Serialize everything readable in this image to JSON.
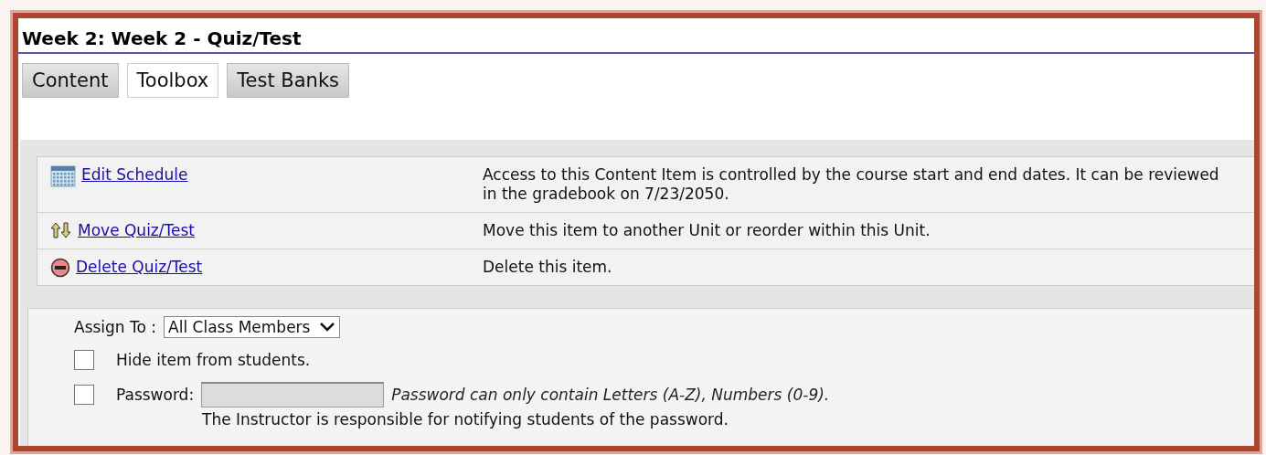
{
  "title": "Week 2: Week 2 - Quiz/Test",
  "tabs": [
    {
      "label": "Content",
      "selected": false
    },
    {
      "label": "Toolbox",
      "selected": true
    },
    {
      "label": "Test Banks",
      "selected": false
    }
  ],
  "actions": [
    {
      "kind": "schedule",
      "label": "Edit Schedule",
      "description": "Access to this Content Item is controlled by the course start and end dates. It can be reviewed in the gradebook on 7/23/2050."
    },
    {
      "kind": "move",
      "label": "Move Quiz/Test",
      "description": "Move this item to another Unit or reorder within this Unit."
    },
    {
      "kind": "delete",
      "label": "Delete Quiz/Test",
      "description": "Delete this item."
    }
  ],
  "assign": {
    "label": "Assign To :",
    "value": "All Class Members"
  },
  "hide": {
    "label": "Hide item from students.",
    "checked": false
  },
  "password": {
    "label": "Password:",
    "checked": false,
    "disabled": true,
    "hint": "Password can only contain Letters (A-Z), Numbers (0-9).",
    "note": "The Instructor is responsible for notifying students of the password."
  }
}
